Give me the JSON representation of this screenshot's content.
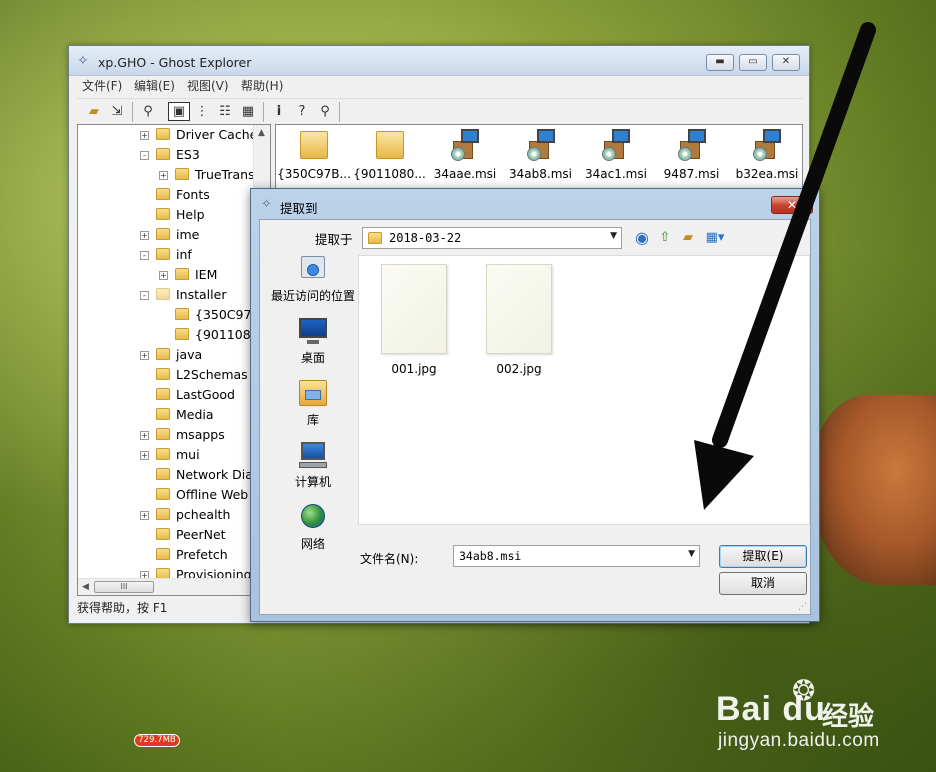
{
  "ghost_window": {
    "title": "xp.GHO - Ghost Explorer",
    "menu": [
      "文件(F)",
      "编辑(E)",
      "视图(V)",
      "帮助(H)"
    ],
    "toolbar_icons": [
      "open-folder-icon",
      "extract-icon",
      "search-icon",
      "large-icons-view-icon",
      "small-icons-view-icon",
      "list-view-icon",
      "details-view-icon",
      "info-icon",
      "help-icon",
      "antenna-icon"
    ],
    "tree": [
      {
        "label": "Driver Cache",
        "expander": "+"
      },
      {
        "label": "ES3",
        "expander": "-"
      },
      {
        "label": "TrueTrans",
        "expander": "+",
        "indent": 1
      },
      {
        "label": "Fonts",
        "expander": ""
      },
      {
        "label": "Help",
        "expander": ""
      },
      {
        "label": "ime",
        "expander": "+"
      },
      {
        "label": "inf",
        "expander": "-"
      },
      {
        "label": "IEM",
        "expander": "+",
        "indent": 1
      },
      {
        "label": "Installer",
        "expander": "-"
      },
      {
        "label": "{350C97B",
        "expander": "",
        "indent": 1
      },
      {
        "label": "{9011080",
        "expander": "",
        "indent": 1
      },
      {
        "label": "java",
        "expander": "+"
      },
      {
        "label": "L2Schemas",
        "expander": ""
      },
      {
        "label": "LastGood",
        "expander": ""
      },
      {
        "label": "Media",
        "expander": ""
      },
      {
        "label": "msapps",
        "expander": "+"
      },
      {
        "label": "mui",
        "expander": "+"
      },
      {
        "label": "Network Dia",
        "expander": ""
      },
      {
        "label": "Offline Web",
        "expander": ""
      },
      {
        "label": "pchealth",
        "expander": "+"
      },
      {
        "label": "PeerNet",
        "expander": ""
      },
      {
        "label": "Prefetch",
        "expander": ""
      },
      {
        "label": "Provisioning",
        "expander": "+"
      }
    ],
    "files": [
      {
        "name": "{350C97B...",
        "type": "folder"
      },
      {
        "name": "{9011080...",
        "type": "folder"
      },
      {
        "name": "34aae.msi",
        "type": "msi"
      },
      {
        "name": "34ab8.msi",
        "type": "msi"
      },
      {
        "name": "34ac1.msi",
        "type": "msi"
      },
      {
        "name": "9487.msi",
        "type": "msi"
      },
      {
        "name": "b32ea.msi",
        "type": "msi"
      }
    ],
    "status": "获得帮助，按 F1",
    "hscroll_thumb": "III"
  },
  "dialog": {
    "title": "提取到",
    "look_in_label": "提取于",
    "look_in_value": "2018-03-22",
    "places": [
      {
        "label": "最近访问的位置",
        "icon": "recent-places-icon"
      },
      {
        "label": "桌面",
        "icon": "desktop-icon"
      },
      {
        "label": "库",
        "icon": "libraries-icon"
      },
      {
        "label": "计算机",
        "icon": "computer-icon"
      },
      {
        "label": "网络",
        "icon": "network-icon"
      }
    ],
    "files": [
      "001.jpg",
      "002.jpg"
    ],
    "filename_label": "文件名(N):",
    "filename_value": "34ab8.msi",
    "extract_button": "提取(E)",
    "cancel_button": "取消"
  },
  "overlay": {
    "badge": "729.7MB",
    "watermark_brand": "Bai du",
    "watermark_cn": "经验",
    "watermark_url": "jingyan.baidu.com"
  }
}
